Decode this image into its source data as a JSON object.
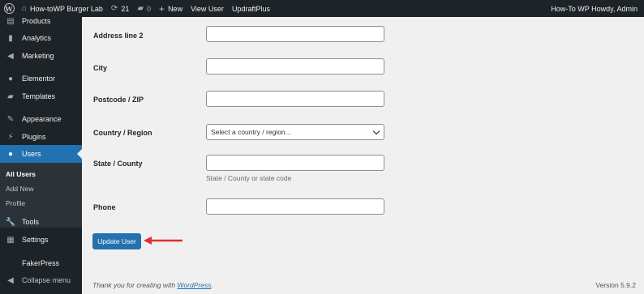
{
  "admin_bar": {
    "site_name": "How-toWP Burger Lab",
    "updates_count": "21",
    "comments_count": "0",
    "new_label": "New",
    "view_user_label": "View User",
    "updraft_label": "UpdraftPlus",
    "howdy_label": "How-To WP Howdy, Admin"
  },
  "sidebar": {
    "items": [
      {
        "label": "Products",
        "icon": "products-icon"
      },
      {
        "label": "Analytics",
        "icon": "analytics-icon"
      },
      {
        "label": "Marketing",
        "icon": "marketing-icon"
      },
      {
        "label": "Elementor",
        "icon": "elementor-icon"
      },
      {
        "label": "Templates",
        "icon": "templates-icon"
      },
      {
        "label": "Appearance",
        "icon": "appearance-icon"
      },
      {
        "label": "Plugins",
        "icon": "plugins-icon"
      },
      {
        "label": "Users",
        "icon": "users-icon"
      },
      {
        "label": "Tools",
        "icon": "tools-icon"
      },
      {
        "label": "Settings",
        "icon": "settings-icon"
      },
      {
        "label": "FakerPress",
        "icon": ""
      },
      {
        "label": "Collapse menu",
        "icon": "collapse-icon"
      }
    ],
    "submenu": [
      "All Users",
      "Add New",
      "Profile"
    ]
  },
  "form": {
    "address2_label": "Address line 2",
    "city_label": "City",
    "postcode_label": "Postcode / ZIP",
    "country_label": "Country / Region",
    "country_placeholder": "Select a country / region...",
    "state_label": "State / County",
    "state_desc": "State / County or state code",
    "phone_label": "Phone",
    "address2_value": "",
    "city_value": "",
    "postcode_value": "",
    "state_value": "",
    "phone_value": ""
  },
  "update_button": "Update User",
  "footer": {
    "thanks_prefix": "Thank you for creating with ",
    "thanks_link": "WordPress",
    "thanks_suffix": ".",
    "version": "Version 5.9.2"
  },
  "colors": {
    "admin_bar": "#1d2327",
    "accent": "#2271b1",
    "background": "#f0f0f1",
    "arrow": "#e02f2f"
  }
}
